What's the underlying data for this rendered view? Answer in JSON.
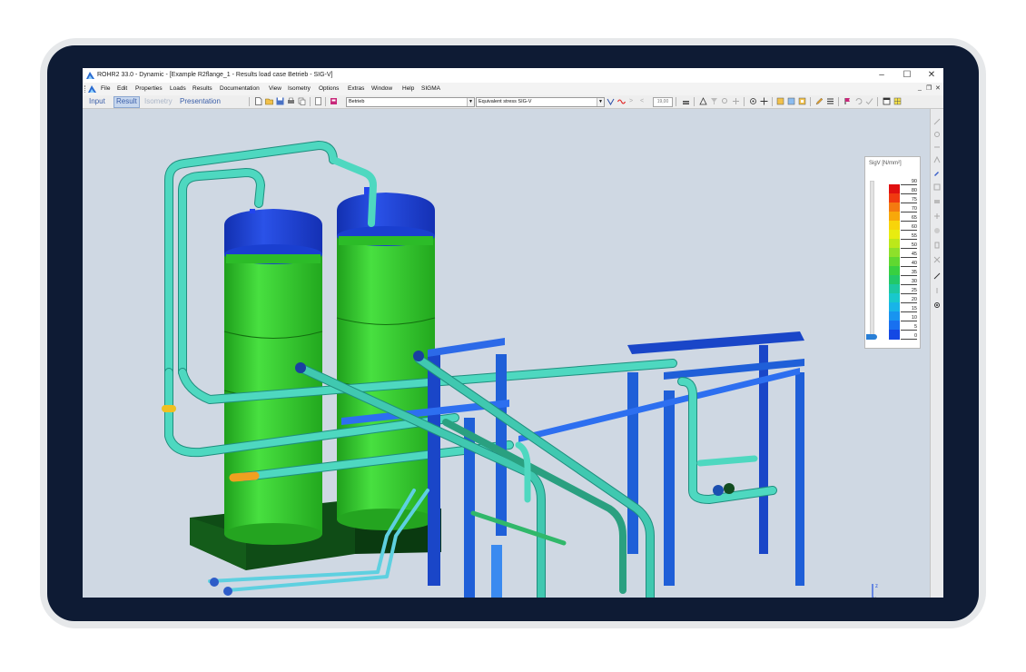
{
  "window": {
    "title": "ROHR2 33.0 - Dynamic - [Example R2flange_1 - Results load case Betrieb - SIG-V]",
    "controls": [
      "–",
      "☐",
      "✕"
    ],
    "mdi_controls": [
      "_",
      "❐",
      "✕"
    ]
  },
  "menu": [
    "File",
    "Edit",
    "Properties",
    "Loads",
    "Results",
    "Documentation",
    "View",
    "Isometry",
    "Options",
    "Extras",
    "Window",
    "Help",
    "SIGMA"
  ],
  "toolbar": {
    "modes": [
      {
        "label": "Input",
        "state": "normal"
      },
      {
        "label": "Result",
        "state": "active"
      },
      {
        "label": "Isometry",
        "state": "disabled"
      },
      {
        "label": "Presentation",
        "state": "normal"
      }
    ],
    "load_case": "Betrieb",
    "result_type": "Equivalent stress SIG-V",
    "scale_value": "19,00"
  },
  "legend": {
    "title": "SigV [N/mm²]",
    "tick_labels": [
      "90",
      "80",
      "75",
      "70",
      "65",
      "60",
      "55",
      "50",
      "45",
      "40",
      "35",
      "30",
      "25",
      "20",
      "15",
      "10",
      "5",
      "0"
    ],
    "colors": [
      "#e01010",
      "#f03a10",
      "#f47a10",
      "#f8a80a",
      "#f8d40a",
      "#e8ec10",
      "#bce81a",
      "#8ee02a",
      "#60d830",
      "#38d040",
      "#22c868",
      "#1cc8a0",
      "#18c8cc",
      "#18b4e8",
      "#1894f0",
      "#1870f0",
      "#1448e4"
    ]
  },
  "colors": {
    "device_frame": "#0e1b34",
    "viewport_bg": "#cfd8e3",
    "vessel_green": "#34c832",
    "vessel_cap": "#1a3fd0",
    "pipe_cyan": "#4ed8c0",
    "steel_blue": "#1f5fd8"
  }
}
